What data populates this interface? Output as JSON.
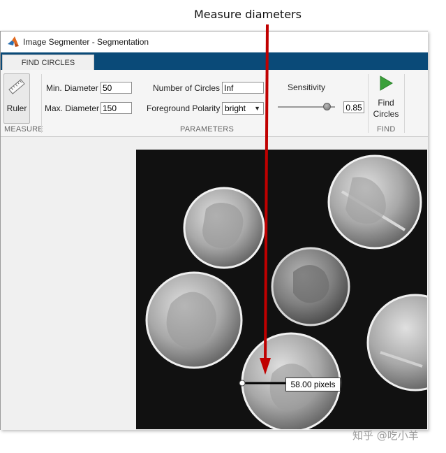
{
  "annotation": {
    "text": "Measure diameters"
  },
  "window": {
    "title": "Image Segmenter - Segmentation"
  },
  "tabs": [
    {
      "label": "FIND CIRCLES",
      "active": true
    }
  ],
  "toolstrip": {
    "measure": {
      "ruler_label": "Ruler",
      "section_label": "MEASURE"
    },
    "parameters": {
      "section_label": "PARAMETERS",
      "min_diameter_label": "Min. Diameter",
      "min_diameter_value": "50",
      "max_diameter_label": "Max. Diameter",
      "max_diameter_value": "150",
      "num_circles_label": "Number of Circles",
      "num_circles_value": "Inf",
      "foreground_polarity_label": "Foreground Polarity",
      "foreground_polarity_value": "bright",
      "sensitivity_label": "Sensitivity",
      "sensitivity_value": "0.85",
      "sensitivity_level": 0.85
    },
    "find": {
      "button_label_line1": "Find",
      "button_label_line2": "Circles",
      "section_label": "FIND"
    }
  },
  "measurement": {
    "label": "58.00 pixels"
  },
  "watermark": {
    "text": "知乎 @吃小羊"
  },
  "colors": {
    "tab_strip": "#0a4a78",
    "arrow": "#c00000",
    "play_icon": "#3aa03a"
  }
}
